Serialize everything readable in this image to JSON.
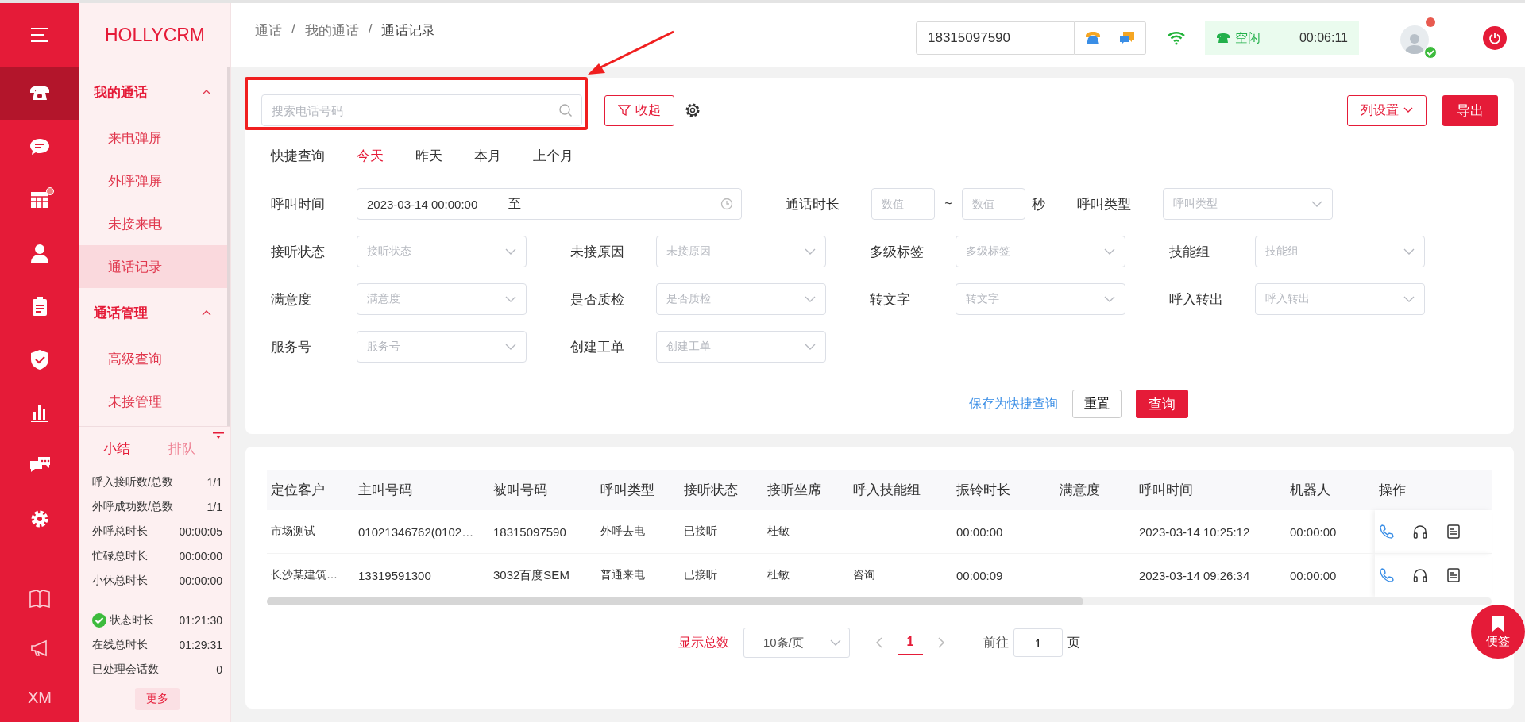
{
  "rail": {
    "items": [
      {
        "kind": "phone",
        "selected": true,
        "badge": false
      },
      {
        "kind": "chat",
        "selected": false,
        "badge": false
      },
      {
        "kind": "grid",
        "selected": false,
        "badge": true
      },
      {
        "kind": "person",
        "selected": false,
        "badge": false
      },
      {
        "kind": "clipboard",
        "selected": false,
        "badge": false
      },
      {
        "kind": "shield",
        "selected": false,
        "badge": false
      },
      {
        "kind": "barchart",
        "selected": false,
        "badge": false
      },
      {
        "kind": "chats",
        "selected": false,
        "badge": false
      },
      {
        "kind": "gear",
        "selected": false,
        "badge": false
      }
    ],
    "bottom_items": [
      {
        "kind": "book",
        "selected": false
      },
      {
        "kind": "megaphone",
        "selected": false
      },
      {
        "kind": "text",
        "label": "XM",
        "selected": false
      }
    ]
  },
  "brand": "HOLLYCRM",
  "nav": [
    {
      "title": "我的通话",
      "expanded": true,
      "items": [
        {
          "label": "来电弹屏",
          "selected": false
        },
        {
          "label": "外呼弹屏",
          "selected": false
        },
        {
          "label": "未接来电",
          "selected": false
        },
        {
          "label": "通话记录",
          "selected": true
        }
      ]
    },
    {
      "title": "通话管理",
      "expanded": true,
      "items": [
        {
          "label": "高级查询",
          "selected": false
        },
        {
          "label": "未接管理",
          "selected": false
        }
      ]
    }
  ],
  "summary": {
    "tabs": [
      {
        "label": "小结",
        "selected": true
      },
      {
        "label": "排队",
        "selected": false
      }
    ],
    "stats": [
      {
        "label": "呼入接听数/总数",
        "value": "1/1"
      },
      {
        "label": "外呼成功数/总数",
        "value": "1/1"
      },
      {
        "label": "外呼总时长",
        "value": "00:00:05"
      },
      {
        "label": "忙碌总时长",
        "value": "00:00:00"
      },
      {
        "label": "小休总时长",
        "value": "00:00:00"
      }
    ],
    "status_stats": [
      {
        "kind": "status",
        "label": "状态时长",
        "value": "01:21:30"
      },
      {
        "kind": "plain",
        "label": "在线总时长",
        "value": "01:29:31"
      },
      {
        "kind": "plain",
        "label": "已处理会话数",
        "value": "0"
      }
    ],
    "more_button": "更多"
  },
  "header": {
    "breadcrumb": [
      "通话",
      "我的通话",
      "通话记录"
    ],
    "separator": "/",
    "phone_number": "18315097590",
    "status": "空闲",
    "timer": "00:06:11",
    "avatar_notification": true,
    "avatar_online": true
  },
  "filter": {
    "search": {
      "placeholder": "搜索电话号码"
    },
    "collapse_button": "收起",
    "column_settings_button": "列设置",
    "export_button": "导出",
    "quick": {
      "label": "快捷查询",
      "options": [
        {
          "label": "今天",
          "selected": true
        },
        {
          "label": "昨天",
          "selected": false
        },
        {
          "label": "本月",
          "selected": false
        },
        {
          "label": "上个月",
          "selected": false
        }
      ]
    },
    "time_row": [
      {
        "kind": "date_range",
        "label": "呼叫时间",
        "value": "2023-03-14 00:00:00",
        "separator": "至"
      },
      {
        "kind": "number_range",
        "label": "通话时长",
        "placeholder_from": "数值",
        "placeholder_to": "数值",
        "separator": "~",
        "unit": "秒"
      },
      {
        "kind": "select",
        "label": "呼叫类型",
        "placeholder": "呼叫类型"
      }
    ],
    "rows": [
      [
        {
          "kind": "select",
          "label": "接听状态",
          "placeholder": "接听状态"
        },
        {
          "kind": "select",
          "label": "未接原因",
          "placeholder": "未接原因"
        },
        {
          "kind": "select",
          "label": "多级标签",
          "placeholder": "多级标签"
        },
        {
          "kind": "select",
          "label": "技能组",
          "placeholder": "技能组"
        }
      ],
      [
        {
          "kind": "select",
          "label": "满意度",
          "placeholder": "满意度"
        },
        {
          "kind": "select",
          "label": "是否质检",
          "placeholder": "是否质检"
        },
        {
          "kind": "select",
          "label": "转文字",
          "placeholder": "转文字"
        },
        {
          "kind": "select",
          "label": "呼入转出",
          "placeholder": "呼入转出"
        }
      ],
      [
        {
          "kind": "select",
          "label": "服务号",
          "placeholder": "服务号"
        },
        {
          "kind": "select",
          "label": "创建工单",
          "placeholder": "创建工单"
        }
      ]
    ],
    "save_link": "保存为快捷查询",
    "reset_button": "重置",
    "query_button": "查询"
  },
  "table": {
    "columns": [
      "定位客户",
      "主叫号码",
      "被叫号码",
      "呼叫类型",
      "接听状态",
      "接听坐席",
      "呼入技能组",
      "振铃时长",
      "满意度",
      "呼叫时间",
      "机器人",
      "操作"
    ],
    "rows": [
      [
        "市场测试",
        "01021346762(0102…",
        "18315097590",
        "外呼去电",
        "已接听",
        "杜敏",
        "",
        "00:00:00",
        "",
        "2023-03-14 10:25:12",
        "00:00:00"
      ],
      [
        "长沙某建筑…",
        "13319591300",
        "3032百度SEM",
        "普通来电",
        "已接听",
        "杜敏",
        "咨询",
        "00:00:09",
        "",
        "2023-03-14 09:26:34",
        "00:00:00"
      ]
    ]
  },
  "pagination": {
    "total_label": "显示总数",
    "page_size": "10条/页",
    "pages": [
      {
        "label": "1",
        "selected": true
      }
    ],
    "goto_label": "前往",
    "goto_value": "1",
    "goto_suffix": "页"
  },
  "note_button": "便签"
}
